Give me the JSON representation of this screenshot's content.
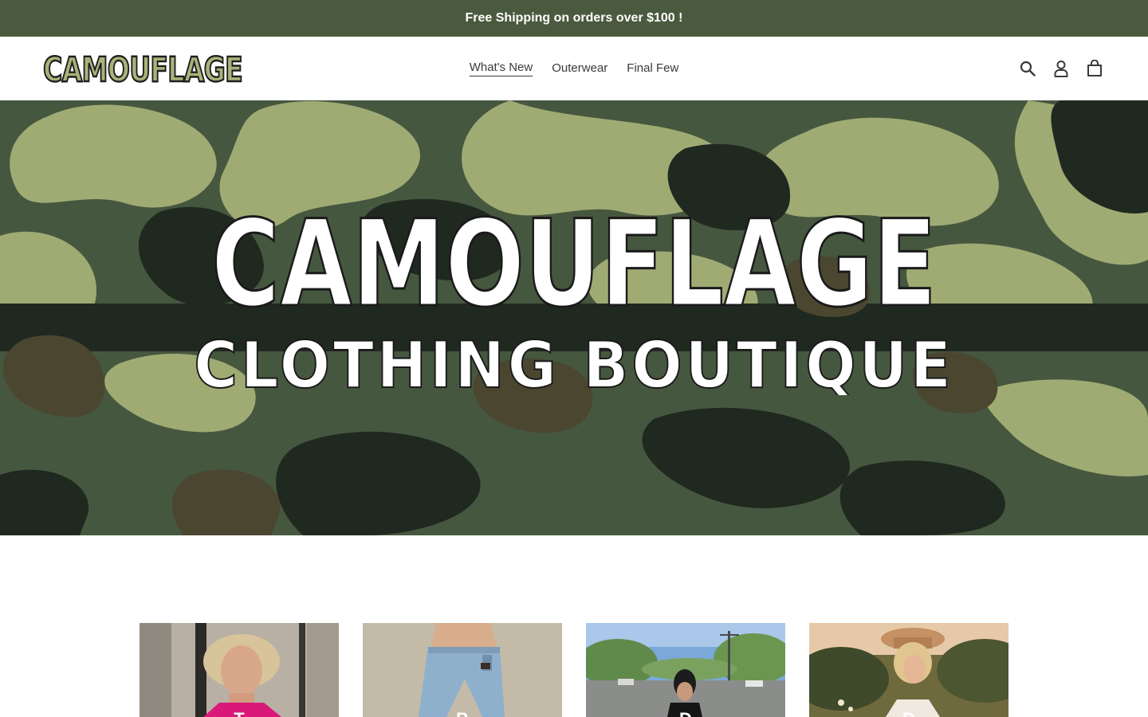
{
  "announcement": {
    "text": "Free Shipping on orders over $100 !"
  },
  "header": {
    "logo_text": "CAMOUFLAGE",
    "nav": [
      {
        "label": "What's New",
        "active": true
      },
      {
        "label": "Outerwear",
        "active": false
      },
      {
        "label": "Final Few",
        "active": false
      }
    ],
    "icons": [
      "search-icon",
      "account-icon",
      "cart-icon"
    ]
  },
  "hero": {
    "title": "CAMOUFLAGE",
    "subtitle": "CLOTHING BOUTIQUE"
  },
  "collections": [
    {
      "label": "T",
      "image": "woman in pink top"
    },
    {
      "label": "B",
      "image": "light wash jeans"
    },
    {
      "label": "D",
      "image": "woman in black dress outdoors"
    },
    {
      "label": "D",
      "image": "woman in hat at sunset"
    }
  ],
  "colors": {
    "announcement_bg": "#4a5a3e",
    "camo_light": "#a0ab74",
    "camo_mid": "#46573f",
    "camo_dark": "#202920",
    "camo_brown": "#4a4630"
  }
}
